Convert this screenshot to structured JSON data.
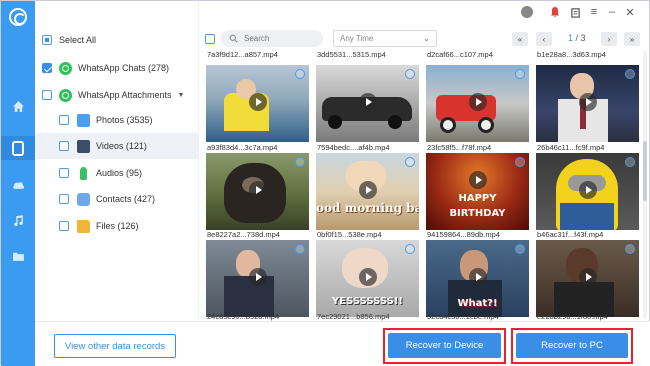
{
  "colors": {
    "accent": "#3a8ee6",
    "rail": "#3a9bf0",
    "highlight": "#e8232a",
    "whatsapp": "#2fc25b"
  },
  "rail": {
    "items": [
      "logo-icon",
      "home-icon",
      "device-icon",
      "cloud-icon",
      "music-icon",
      "folder-icon"
    ],
    "active": "device-icon"
  },
  "sidebar": {
    "select_all": "Select All",
    "whatsapp_chats": "WhatsApp Chats (278)",
    "whatsapp_attachments": "WhatsApp Attachments",
    "items": [
      {
        "label": "Photos (3535)",
        "icon": "photos-icon"
      },
      {
        "label": "Videos (121)",
        "icon": "videos-icon",
        "active": true
      },
      {
        "label": "Audios (95)",
        "icon": "microphone-icon"
      },
      {
        "label": "Contacts (427)",
        "icon": "contacts-icon"
      },
      {
        "label": "Files (126)",
        "icon": "folder-icon"
      }
    ]
  },
  "toolbar": {
    "icons": [
      "user-icon",
      "bell-icon",
      "clipboard-icon",
      "menu-icon",
      "minimize-icon",
      "close-icon"
    ]
  },
  "filters": {
    "search_placeholder": "Search",
    "time_filter": "Any Time",
    "page_current": "1",
    "page_total": "/ 3"
  },
  "grid": {
    "top_partial": [
      "7a3f9d12...a857.mp4",
      "3dd5531...5315.mp4",
      "d2caf66...c107.mp4",
      "b1e28a8...3d63.mp4"
    ],
    "rows": [
      [
        "a93f83d4...3c7a.mp4",
        "7594bedc....af4b.mp4",
        "23fc58f5...f78f.mp4",
        "26b46c11...fc9f.mp4"
      ],
      [
        "8e8227a2...738d.mp4",
        "0bf0f15...538e.mp4",
        "94159864...89db.mp4",
        "b46ac31f...f43f.mp4"
      ],
      [
        "24c85c90...b926.mp4",
        "7ec29021...b856.mp4",
        "52cb4c30...1cbe.mp4",
        "e228b29b...1f86.mp4"
      ]
    ],
    "overlay_texts": {
      "good_morning": "ood morning baby",
      "happy": "HAPPY",
      "birthday": "BIRTHDAY",
      "yes": "YESSSSSSS!!",
      "what": "What?!"
    }
  },
  "footer": {
    "view_other": "View other data records",
    "recover_device": "Recover to Device",
    "recover_pc": "Recover to PC"
  }
}
